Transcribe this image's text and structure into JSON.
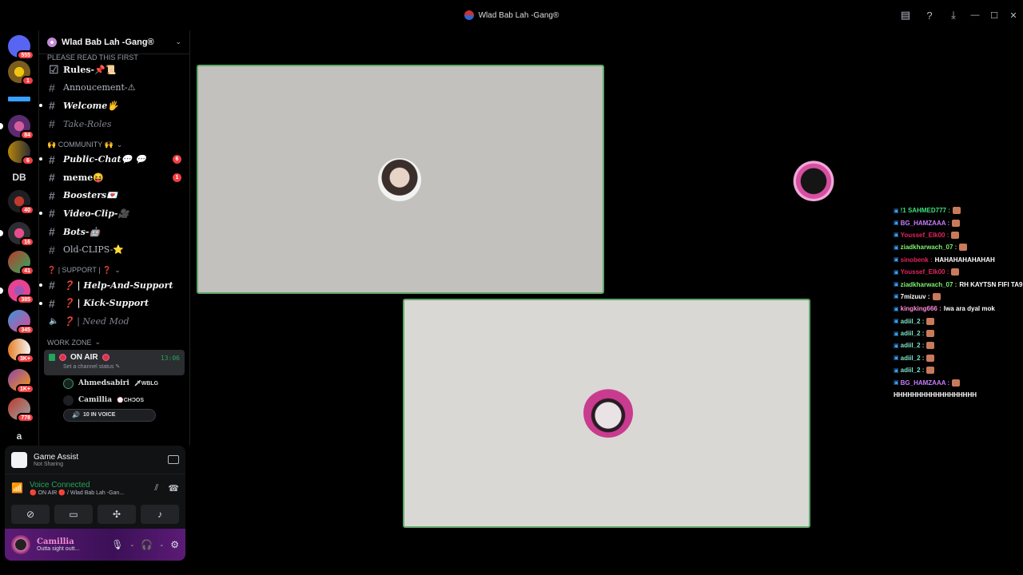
{
  "window": {
    "title": "Wlad Bab Lah -Gang®",
    "buttons": [
      "inbox-icon",
      "help-icon",
      "download-icon",
      "minimize",
      "maximize",
      "close"
    ],
    "minimize_glyph": "—",
    "maximize_glyph": "☐",
    "close_glyph": "✕"
  },
  "rail": {
    "servers": [
      {
        "badge": "555"
      },
      {
        "badge": "1"
      },
      {
        "badge": ""
      },
      {
        "badge": "84"
      },
      {
        "badge": "6"
      },
      {
        "badge": ""
      },
      {
        "badge": "40"
      },
      {
        "badge": "16"
      },
      {
        "badge": "41"
      },
      {
        "badge": "385"
      },
      {
        "badge": "345"
      },
      {
        "badge": "3K+"
      },
      {
        "badge": "1K+"
      },
      {
        "badge": "778"
      }
    ],
    "letter_server": "a",
    "db_server": "DB"
  },
  "server": {
    "name": "Wlad Bab Lah -Gang®",
    "top_category": "PLEASE READ THIS FIRST",
    "channels_top": [
      {
        "name": "Rules-📌📜",
        "icon": "☑"
      },
      {
        "name": "Annoucement-⚠",
        "icon": "#"
      },
      {
        "name": "Welcome🖐",
        "icon": "#"
      },
      {
        "name": "Take-Roles",
        "icon": "#"
      }
    ],
    "community_category": "🙌 COMMUNITY 🙌",
    "channels_community": [
      {
        "name": "Public-Chat💬 💬",
        "badge": "6"
      },
      {
        "name": "meme😝",
        "badge": "1"
      },
      {
        "name": "Boosters💌",
        "badge": ""
      },
      {
        "name": "Video-Clip-🎥",
        "badge": ""
      },
      {
        "name": "Bots-🤖",
        "badge": ""
      },
      {
        "name": "Old-CLIPS-⭐",
        "badge": ""
      }
    ],
    "support_category": "❓ | SUPPORT | ❓",
    "channels_support": [
      {
        "name": "❓ | Help-And-Support"
      },
      {
        "name": "❓ | Kick-Support"
      },
      {
        "name": "❓ | Need Mod"
      }
    ],
    "work_category": "WORK ZONE",
    "voice_channel": {
      "name": "ON AIR",
      "time": "13:06",
      "status_placeholder": "Set a channel status"
    },
    "voice_users": [
      {
        "name": "Ahmedsabiri",
        "tag": "🗡WBLG"
      },
      {
        "name": "Camillia",
        "tag": "💮CHƆOS"
      }
    ],
    "in_voice": "10 IN VOICE"
  },
  "panel": {
    "game_assist_title": "Game Assist",
    "game_assist_status": "Not Sharing",
    "voice_connected": "Voice Connected",
    "voice_location": "🔴 ON AIR 🔴 / Wlad Bab Lah -Gan...",
    "buttons": [
      "camera-off-icon",
      "screen-share-icon",
      "activities-icon",
      "soundboard-icon"
    ],
    "user_name": "Camillia",
    "user_status": "Outta sight outt..."
  },
  "chat": [
    {
      "user": "!1 SAHMED777 :",
      "color": "#3ee07a",
      "text": ""
    },
    {
      "user": "BG_HAMZAAA :",
      "color": "#c77dff",
      "text": ""
    },
    {
      "user": "Youssef_Elk00 :",
      "color": "#e3245f",
      "text": ""
    },
    {
      "user": "ziadkharwach_07 :",
      "color": "#7cf26f",
      "text": ""
    },
    {
      "user": "sinobenk :",
      "color": "#e3245f",
      "text": "HAHAHAHAHAHAH"
    },
    {
      "user": "Youssef_Elk00 :",
      "color": "#e3245f",
      "text": ""
    },
    {
      "user": "ziadkharwach_07 :",
      "color": "#7cf26f",
      "text": "RH KAYTSN FIFI TA9"
    },
    {
      "user": "7mizuuv :",
      "color": "#ffffff",
      "text": ""
    },
    {
      "user": "kingking666 :",
      "color": "#ff8ad8",
      "text": "lwa ara dyal mok"
    },
    {
      "user": "adiil_2 :",
      "color": "#7de3c8",
      "text": ""
    },
    {
      "user": "adiil_2 :",
      "color": "#7de3c8",
      "text": ""
    },
    {
      "user": "adiil_2 :",
      "color": "#7de3c8",
      "text": ""
    },
    {
      "user": "adiil_2 :",
      "color": "#7de3c8",
      "text": ""
    },
    {
      "user": "adiil_2 :",
      "color": "#7de3c8",
      "text": ""
    },
    {
      "user": "BG_HAMZAAA :",
      "color": "#c77dff",
      "text": ""
    },
    {
      "user": "",
      "color": "#ffffff",
      "text": "HHHHHHHHHHHHHHHHHH"
    }
  ],
  "colors": {
    "accent_green": "#23a55a",
    "badge_red": "#f23f43",
    "tile_border": "#5fa86a",
    "user_bar": "#3c1057"
  }
}
